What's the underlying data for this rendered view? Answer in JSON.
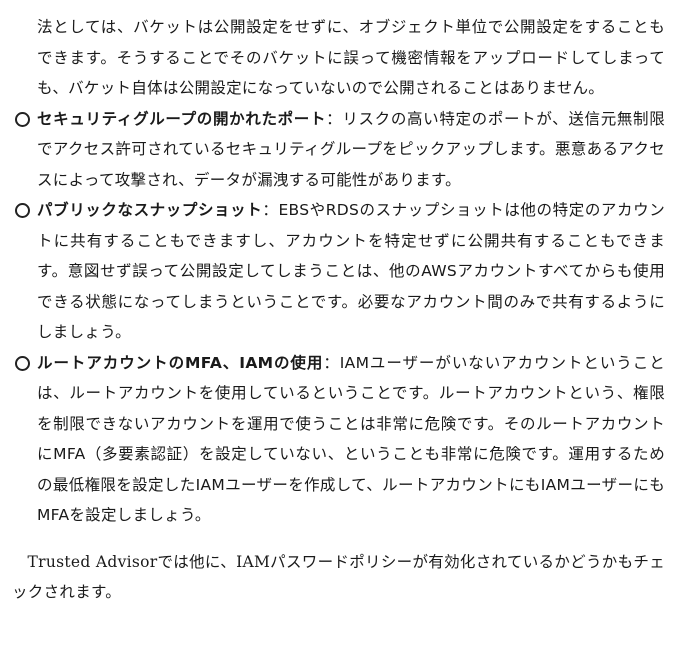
{
  "intro": {
    "text": "法としては、バケットは公開設定をせずに、オブジェクト単位で公開設定をすることもできます。そうすることでそのバケットに誤って機密情報をアップロードしてしまっても、バケット自体は公開設定になっていないので公開されることはありません。"
  },
  "bullets": [
    {
      "term": "セキュリティグループの開かれたポート",
      "separator": "：",
      "text": "リスクの高い特定のポートが、送信元無制限でアクセス許可されているセキュリティグループをピックアップします。悪意あるアクセスによって攻撃され、データが漏洩する可能性があります。"
    },
    {
      "term": "パブリックなスナップショット",
      "separator": "：",
      "text": "EBSやRDSのスナップショットは他の特定のアカウントに共有することもできますし、アカウントを特定せずに公開共有することもできます。意図せず誤って公開設定してしまうことは、他のAWSアカウントすべてからも使用できる状態になってしまうということです。必要なアカウント間のみで共有するようにしましょう。"
    },
    {
      "term": "ルートアカウントのMFA、IAMの使用",
      "separator": "：",
      "text": "IAMユーザーがいないアカウントということは、ルートアカウントを使用しているということです。ルートアカウントという、権限を制限できないアカウントを運用で使うことは非常に危険です。そのルートアカウントにMFA（多要素認証）を設定していない、ということも非常に危険です。運用するための最低権限を設定したIAMユーザーを作成して、ルートアカウントにもIAMユーザーにもMFAを設定しましょう。"
    }
  ],
  "closing": {
    "text": "Trusted Advisorでは他に、IAMパスワードポリシーが有効化されているかどうかもチェックされます。"
  }
}
